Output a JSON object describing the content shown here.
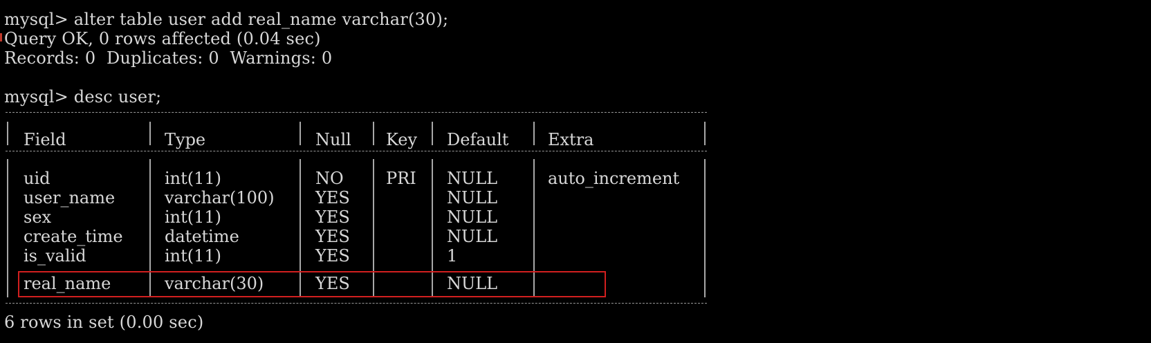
{
  "terminal": {
    "lines": {
      "cmd_alter": "mysql> alter table user add real_name varchar(30);",
      "query_ok": "Query OK, 0 rows affected (0.04 sec)",
      "records": "Records: 0  Duplicates: 0  Warnings: 0",
      "cmd_desc": "mysql> desc user;",
      "summary": "6 rows in set (0.00 sec)"
    }
  },
  "table": {
    "headers": [
      "Field",
      "Type",
      "Null",
      "Key",
      "Default",
      "Extra"
    ],
    "rows": [
      {
        "field": "uid",
        "type": "int(11)",
        "null": "NO",
        "key": "PRI",
        "default": "NULL",
        "extra": "auto_increment"
      },
      {
        "field": "user_name",
        "type": "varchar(100)",
        "null": "YES",
        "key": "",
        "default": "NULL",
        "extra": ""
      },
      {
        "field": "sex",
        "type": "int(11)",
        "null": "YES",
        "key": "",
        "default": "NULL",
        "extra": ""
      },
      {
        "field": "create_time",
        "type": "datetime",
        "null": "YES",
        "key": "",
        "default": "NULL",
        "extra": ""
      },
      {
        "field": "is_valid",
        "type": "int(11)",
        "null": "YES",
        "key": "",
        "default": "1",
        "extra": ""
      },
      {
        "field": "real_name",
        "type": "varchar(30)",
        "null": "YES",
        "key": "",
        "default": "NULL",
        "extra": ""
      }
    ]
  },
  "annotation": {
    "highlight_color": "#d21f1f",
    "highlighted_row": "real_name"
  },
  "colors": {
    "background": "#000000",
    "text": "#d8d8d8"
  }
}
